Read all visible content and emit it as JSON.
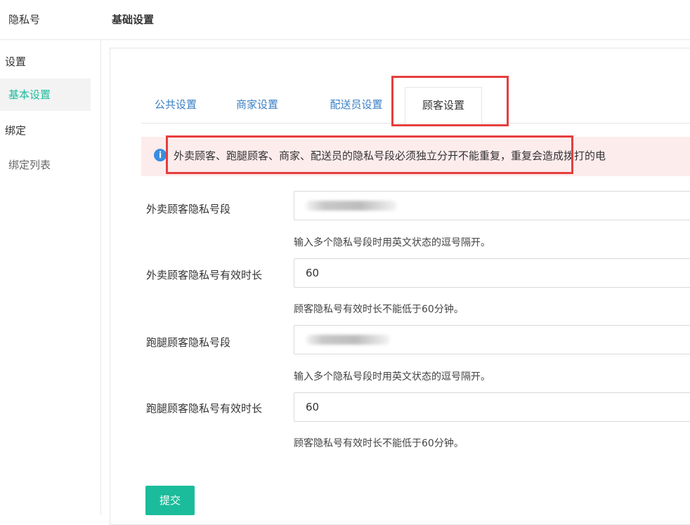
{
  "app": {
    "title": "隐私号"
  },
  "header": {
    "title": "基础设置"
  },
  "sidebar": {
    "groups": [
      {
        "label": "设置",
        "items": [
          {
            "label": "基本设置",
            "active": true
          }
        ]
      },
      {
        "label": "绑定",
        "items": [
          {
            "label": "绑定列表",
            "active": false
          }
        ]
      }
    ]
  },
  "tabs": [
    {
      "label": "公共设置",
      "active": false
    },
    {
      "label": "商家设置",
      "active": false
    },
    {
      "label": "配送员设置",
      "active": false
    },
    {
      "label": "顾客设置",
      "active": true
    }
  ],
  "alert": {
    "icon": "info-icon",
    "text": "外卖顾客、跑腿顾客、商家、配送员的隐私号段必须独立分开不能重复，重复会造成拨打的电"
  },
  "form": {
    "fields": [
      {
        "label": "外卖顾客隐私号段",
        "value": "",
        "hint": "输入多个隐私号段时用英文状态的逗号隔开。"
      },
      {
        "label": "外卖顾客隐私号有效时长",
        "value": "60",
        "hint": "顾客隐私号有效时长不能低于60分钟。"
      },
      {
        "label": "跑腿顾客隐私号段",
        "value": "",
        "hint": "输入多个隐私号段时用英文状态的逗号隔开。"
      },
      {
        "label": "跑腿顾客隐私号有效时长",
        "value": "60",
        "hint": "顾客隐私号有效时长不能低于60分钟。"
      }
    ],
    "submit_label": "提交"
  },
  "colors": {
    "accent": "#1bbc9b",
    "tab_link": "#3a7fc4",
    "alert_bg": "#fdecec",
    "annotation_red": "#e53e3e"
  }
}
